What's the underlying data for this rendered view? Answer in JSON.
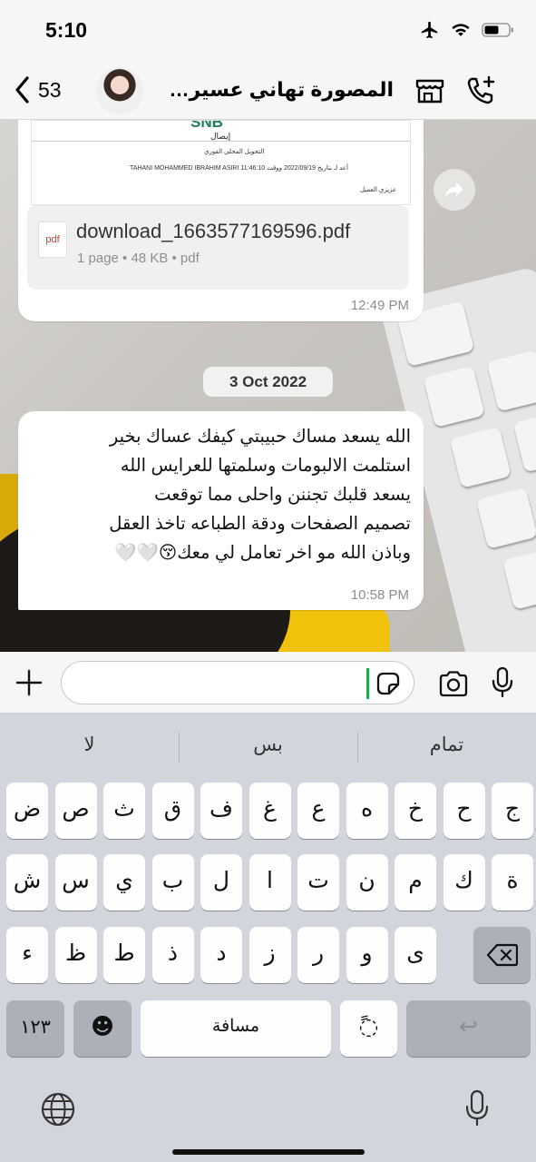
{
  "status_bar": {
    "time": "5:10"
  },
  "header": {
    "back_count": "53",
    "contact_name": "المصورة تهاني عسيري-المـ..."
  },
  "pdf_message": {
    "bank_name": "SNB",
    "preview_title": "إيصال",
    "preview_line1": "التحويل المحلي الفوري",
    "preview_line2": "TAHANI MOHAMMED IBRAHIM ASIRI  أعد لـ  بتاريخ 2022/09/19 ووقت 11:46:10",
    "preview_line3": "عزيزي العميل",
    "preview_pdf_label": "pdf",
    "file_name": "download_1663577169596.pdf",
    "file_meta": "1 page • 48 KB • pdf",
    "time": "12:49 PM"
  },
  "date_separator": "3 Oct 2022",
  "text_message": {
    "text": "الله يسعد مساك حبيبتي كيفك عساك بخير\nاستلمت الالبومات وسلمتها للعرايس الله\nيسعد قلبك تجننن واحلى مما توقعت\nتصميم الصفحات ودقة الطباعه تاخذ العقل\nوباذن الله مو اخر تعامل لي معك😚🤍🤍",
    "time": "10:58 PM"
  },
  "input": {
    "value": "",
    "placeholder": ""
  },
  "keyboard": {
    "suggestions": [
      "لا",
      "بس",
      "تمام"
    ],
    "row1": [
      "ض",
      "ص",
      "ث",
      "ق",
      "ف",
      "غ",
      "ع",
      "ه",
      "خ",
      "ح",
      "ج"
    ],
    "row2": [
      "ش",
      "س",
      "ي",
      "ب",
      "ل",
      "ا",
      "ت",
      "ن",
      "م",
      "ك",
      "ة"
    ],
    "row3": [
      "ء",
      "ظ",
      "ط",
      "ذ",
      "د",
      "ز",
      "ر",
      "و",
      "ى"
    ],
    "numbers_key": "١٢٣",
    "emoji_key": "☻",
    "space_key": "مسافة",
    "diacritic_key": "ً◌",
    "return_key": "↩"
  },
  "icons": [
    "back-chevron-icon",
    "airplane-icon",
    "wifi-icon",
    "battery-icon",
    "store-icon",
    "add-call-icon",
    "forward-icon",
    "plus-icon",
    "sticker-icon",
    "camera-icon",
    "mic-icon",
    "backspace-icon",
    "globe-icon"
  ],
  "colors": {
    "caret": "#23a95a",
    "bank_green": "#1e7d57",
    "pdf_red": "#d8342c"
  }
}
